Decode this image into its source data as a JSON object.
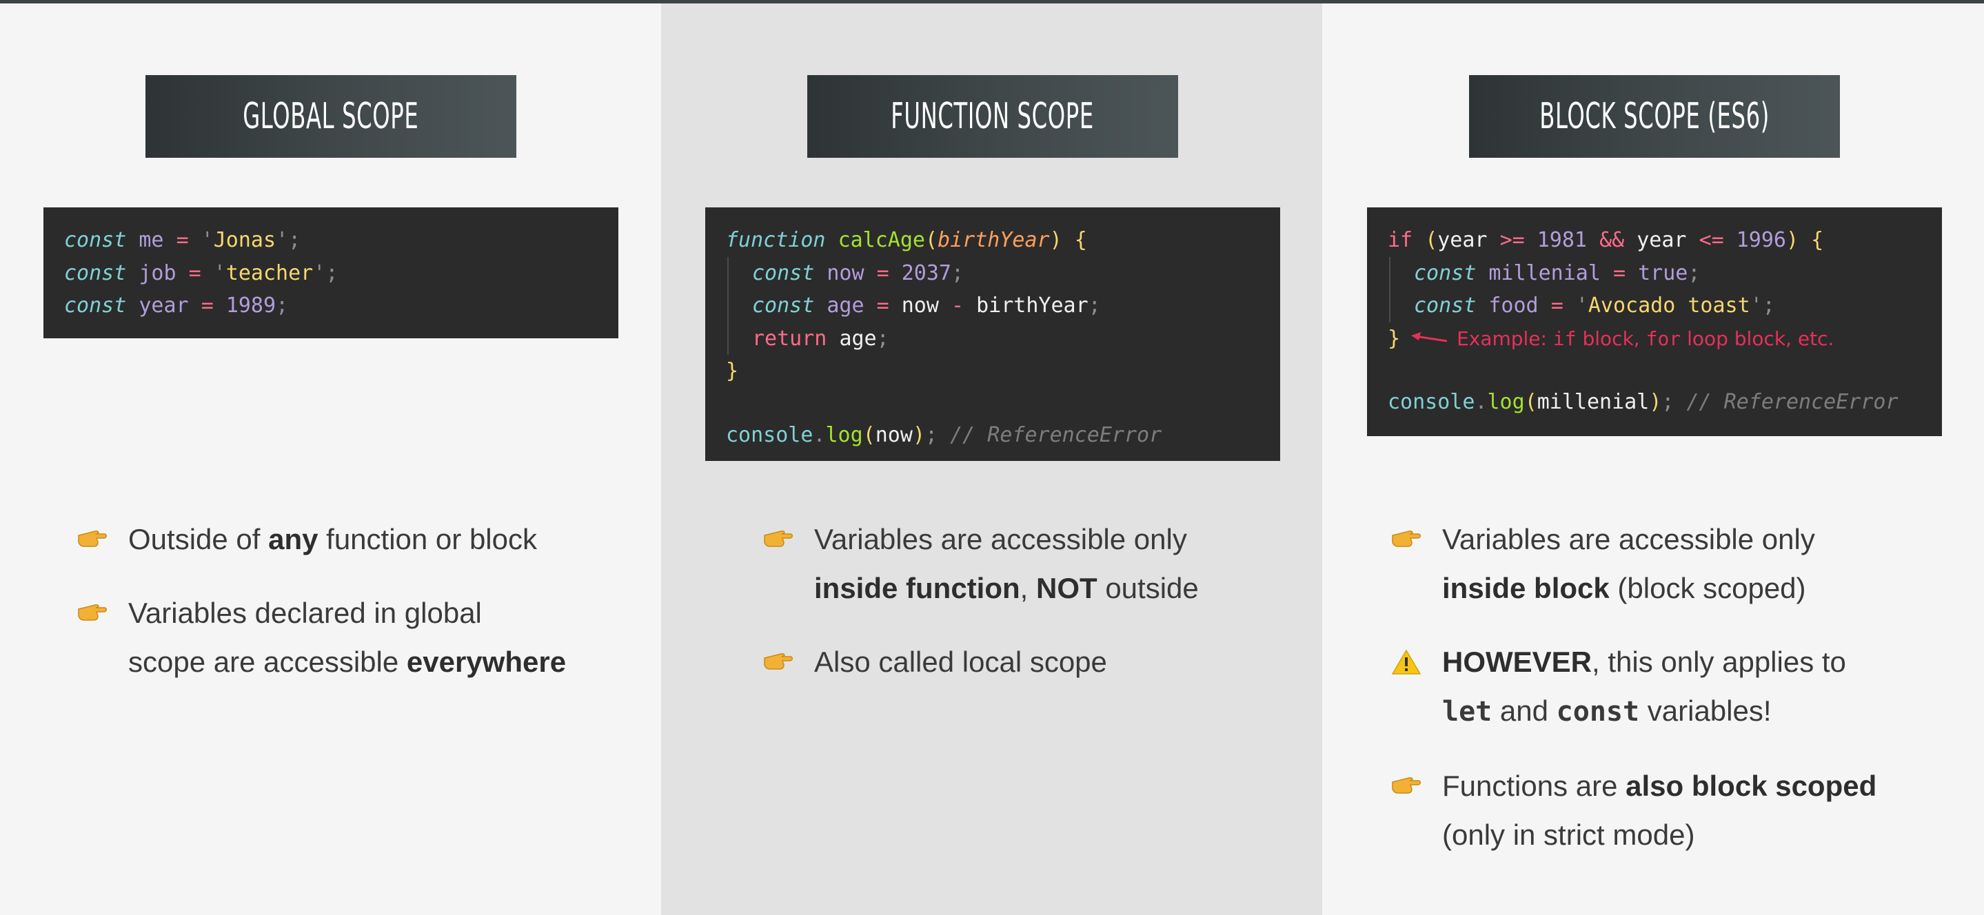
{
  "columns": [
    {
      "title": "GLOBAL SCOPE",
      "code": {
        "l1": {
          "kw": "const",
          "name": "me",
          "op": "=",
          "q1": "'",
          "str": "Jonas",
          "q2": "'",
          "end": ";"
        },
        "l2": {
          "kw": "const",
          "name": "job",
          "op": "=",
          "q1": "'",
          "str": "teacher",
          "q2": "'",
          "end": ";"
        },
        "l3": {
          "kw": "const",
          "name": "year",
          "op": "=",
          "num": "1989",
          "end": ";"
        }
      },
      "bullets": [
        {
          "pre": "Outside of ",
          "bold": "any",
          "post": " function or block"
        },
        {
          "line1": "Variables declared in global",
          "pre": "scope are accessible ",
          "bold": "everywhere"
        }
      ]
    },
    {
      "title": "FUNCTION SCOPE",
      "code": {
        "l1": {
          "kw": "function",
          "fn": "calcAge",
          "open": "(",
          "param": "birthYear",
          "close": ")",
          "brace": "{"
        },
        "l2": {
          "kw": "const",
          "name": "now",
          "op": "=",
          "num": "2037",
          "end": ";"
        },
        "l3": {
          "kw": "const",
          "name": "age",
          "op": "=",
          "a": "now",
          "minus": "-",
          "b": "birthYear",
          "end": ";"
        },
        "l4": {
          "ret": "return",
          "val": "age",
          "end": ";"
        },
        "l5": {
          "brace": "}"
        },
        "l6": {
          "obj": "console",
          "dot": ".",
          "meth": "log",
          "open": "(",
          "arg": "now",
          "close": ")",
          "end": ";",
          "cmt": "// ReferenceError"
        }
      },
      "bullets": [
        {
          "line1": "Variables are accessible only",
          "bold1": "inside function",
          "mid": ", ",
          "bold2": "NOT",
          "post": " outside"
        },
        {
          "text": "Also called local scope"
        }
      ]
    },
    {
      "title": "BLOCK SCOPE (ES6)",
      "code": {
        "l1": {
          "if": "if",
          "open": "(",
          "a": "year",
          "ge": ">=",
          "n1": "1981",
          "and": "&&",
          "b": "year",
          "le": "<=",
          "n2": "1996",
          "close": ")",
          "brace": "{"
        },
        "l2": {
          "kw": "const",
          "name": "millenial",
          "op": "=",
          "val": "true",
          "end": ";"
        },
        "l3": {
          "kw": "const",
          "name": "food",
          "op": "=",
          "q1": "'",
          "str": "Avocado toast",
          "q2": "'",
          "end": ";"
        },
        "l4": {
          "brace": "}",
          "note_pre": "Example: ",
          "note_if": "if",
          "note_mid": " block, ",
          "note_for": "for",
          "note_post": " loop block, etc."
        },
        "l5": {
          "obj": "console",
          "dot": ".",
          "meth": "log",
          "open": "(",
          "arg": "millenial",
          "close": ")",
          "end": ";",
          "cmt": "// ReferenceError"
        }
      },
      "bullets": [
        {
          "line1": "Variables are accessible only",
          "bold": "inside block",
          "post": " (block scoped)"
        },
        {
          "bold": "HOWEVER",
          "post": ", this only applies to",
          "mono1": "let",
          "and": " and ",
          "mono2": "const",
          "tail": " variables!"
        },
        {
          "pre": "Functions are ",
          "bold": "also block scoped",
          "line2": "(only in strict mode)"
        }
      ]
    }
  ],
  "colors": {
    "accent_red": "#e6305a",
    "code_bg": "#2b2b2b",
    "banner_bg": "#3f4749"
  },
  "icons": {
    "bullet": "pointing-hand-icon",
    "warning": "warning-icon"
  }
}
